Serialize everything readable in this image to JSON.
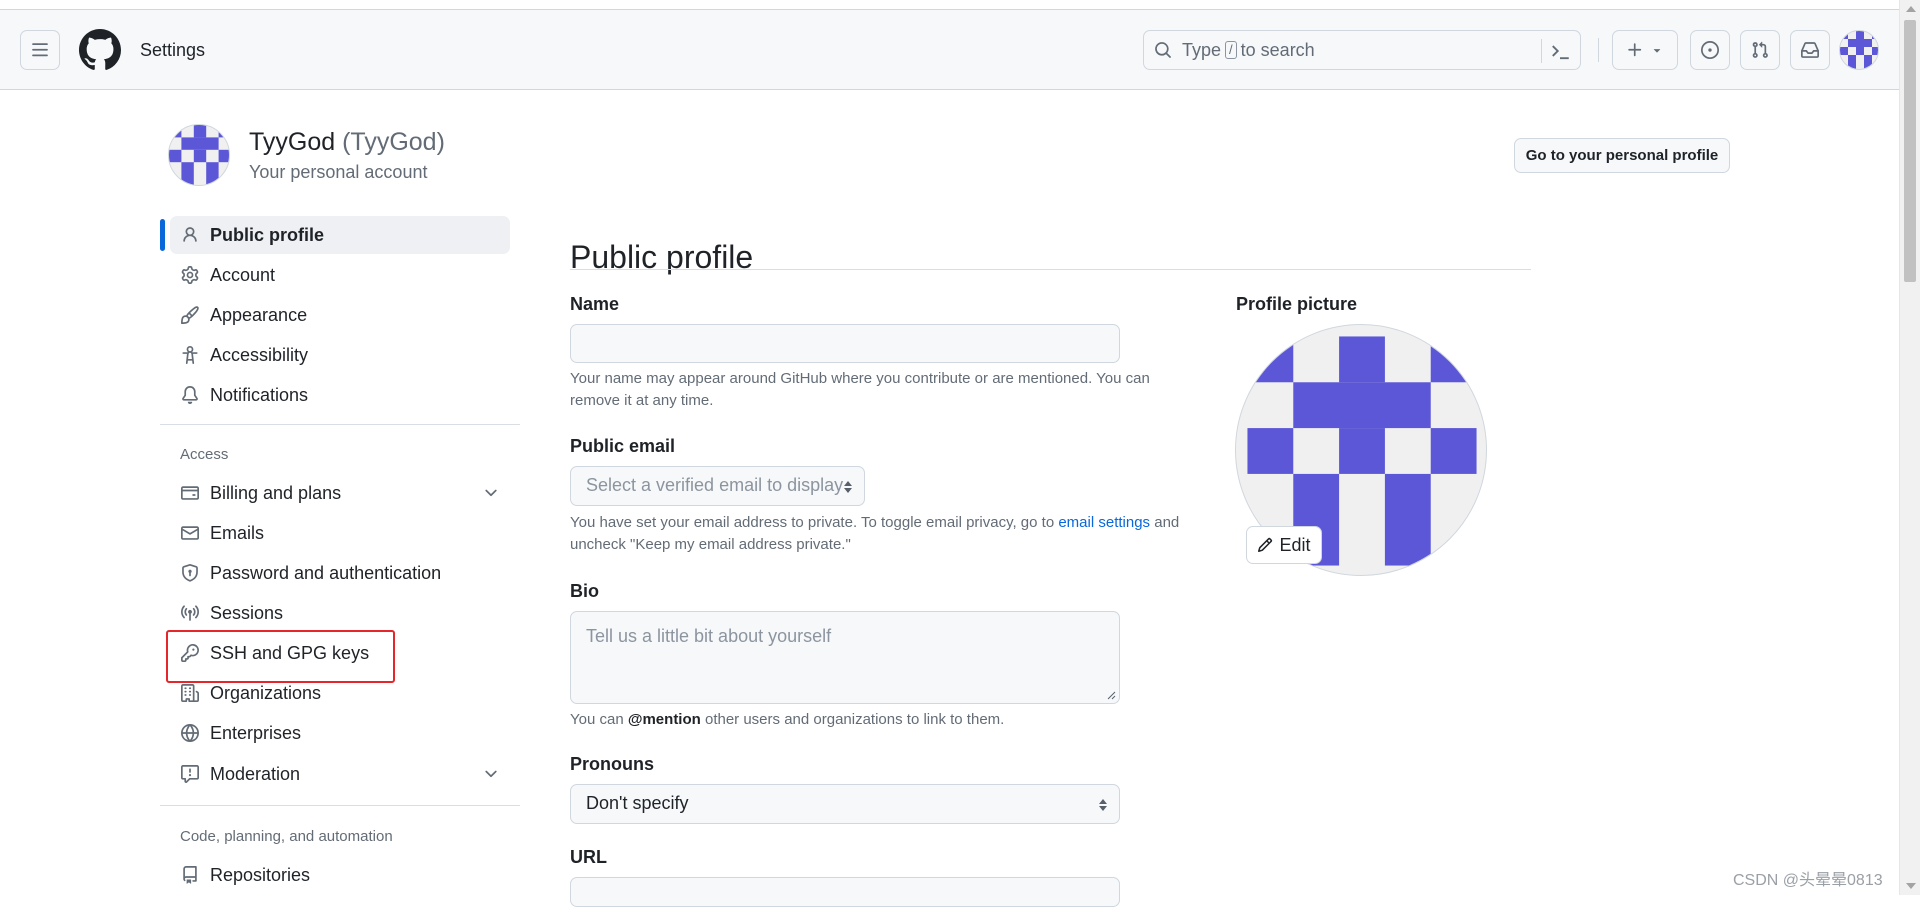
{
  "header": {
    "title": "Settings",
    "search": {
      "prefix": "Type",
      "key": "/",
      "suffix": "to search"
    }
  },
  "account": {
    "name": "TyyGod",
    "login": "(TyyGod)",
    "subtitle": "Your personal account",
    "profile_button": "Go to your personal profile"
  },
  "sidebar": {
    "items": [
      {
        "label": "Public profile",
        "icon": "person-icon",
        "active": true
      },
      {
        "label": "Account",
        "icon": "gear-icon"
      },
      {
        "label": "Appearance",
        "icon": "paintbrush-icon"
      },
      {
        "label": "Accessibility",
        "icon": "accessibility-icon"
      },
      {
        "label": "Notifications",
        "icon": "bell-icon"
      }
    ],
    "access_heading": "Access",
    "access_items": [
      {
        "label": "Billing and plans",
        "icon": "credit-card-icon",
        "expandable": true
      },
      {
        "label": "Emails",
        "icon": "mail-icon"
      },
      {
        "label": "Password and authentication",
        "icon": "shield-lock-icon"
      },
      {
        "label": "Sessions",
        "icon": "broadcast-icon"
      },
      {
        "label": "SSH and GPG keys",
        "icon": "key-icon",
        "highlighted": true
      },
      {
        "label": "Organizations",
        "icon": "organization-icon"
      },
      {
        "label": "Enterprises",
        "icon": "globe-icon"
      },
      {
        "label": "Moderation",
        "icon": "report-icon",
        "expandable": true
      }
    ],
    "code_heading": "Code, planning, and automation",
    "code_items": [
      {
        "label": "Repositories",
        "icon": "repo-icon"
      }
    ]
  },
  "main": {
    "title": "Public profile",
    "name": {
      "label": "Name",
      "value": "",
      "help": "Your name may appear around GitHub where you contribute or are mentioned. You can remove it at any time."
    },
    "public_email": {
      "label": "Public email",
      "selected": "Select a verified email to display",
      "help_before": "You have set your email address to private. To toggle email privacy, go to",
      "help_link": "email settings",
      "help_after": "and uncheck \"Keep my email address private.\""
    },
    "bio": {
      "label": "Bio",
      "placeholder": "Tell us a little bit about yourself",
      "help_before": "You can",
      "help_mention": "@mention",
      "help_after": "other users and organizations to link to them."
    },
    "pronouns": {
      "label": "Pronouns",
      "selected": "Don't specify"
    },
    "url": {
      "label": "URL"
    },
    "profile_picture": {
      "label": "Profile picture",
      "edit_label": "Edit"
    }
  },
  "colors": {
    "accent": "#0969da",
    "avatar": "#5b57d6",
    "highlight": "#e5262b"
  },
  "watermark": "CSDN @头晕晕0813"
}
